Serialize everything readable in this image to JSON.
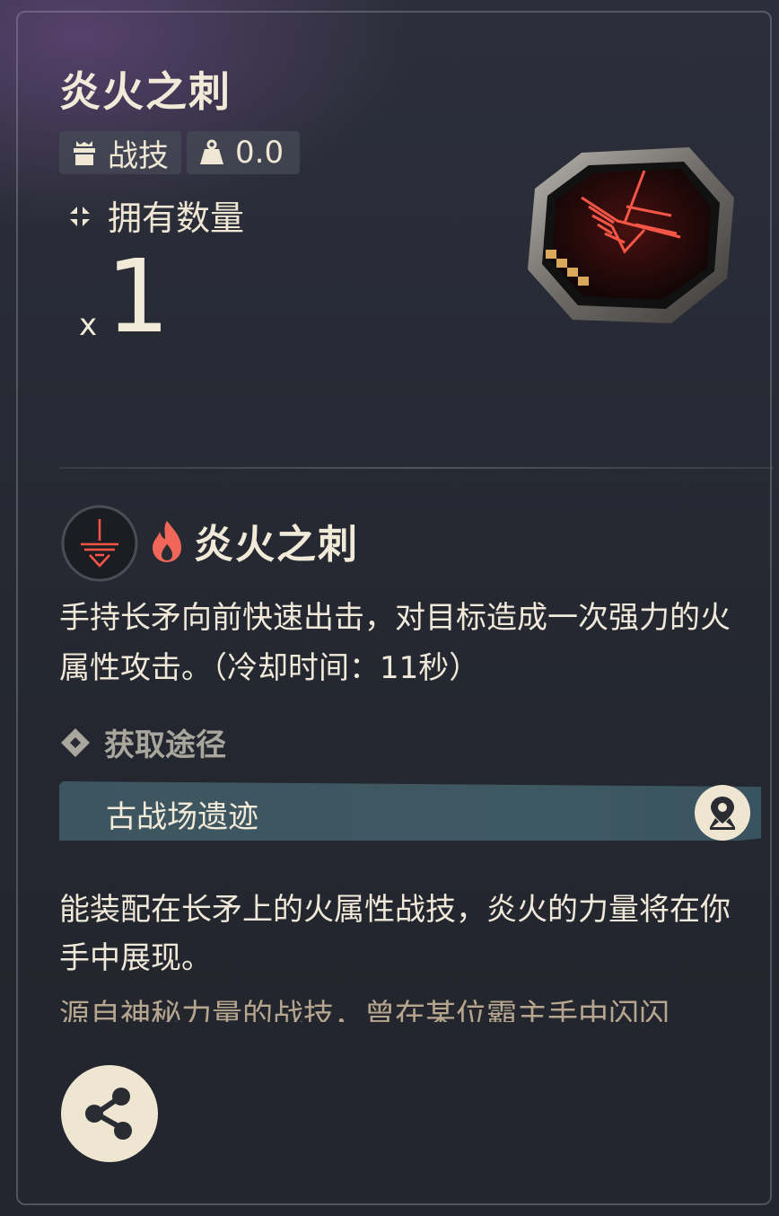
{
  "item": {
    "title": "炎火之刺",
    "type_tag": "战技",
    "weight": "0.0",
    "owned_label": "拥有数量",
    "count_prefix": "x",
    "count": "1"
  },
  "skill": {
    "name": "炎火之刺",
    "element_icon": "fire-icon",
    "description": "手持长矛向前快速出击，对目标造成一次强力的火属性攻击。（冷却时间：11秒）"
  },
  "source": {
    "heading": "获取途径",
    "location": "古战场遗迹"
  },
  "flavor": {
    "text": "能装配在长矛上的火属性战技，炎火的力量将在你手中展现。",
    "text_more": "源自神秘力量的战技，曾在某位霸主手中闪闪"
  },
  "colors": {
    "accent_red": "#e5453a",
    "source_bar": "#3d5560",
    "button_bg": "#efe6d2",
    "text_light": "#f2ead8"
  }
}
